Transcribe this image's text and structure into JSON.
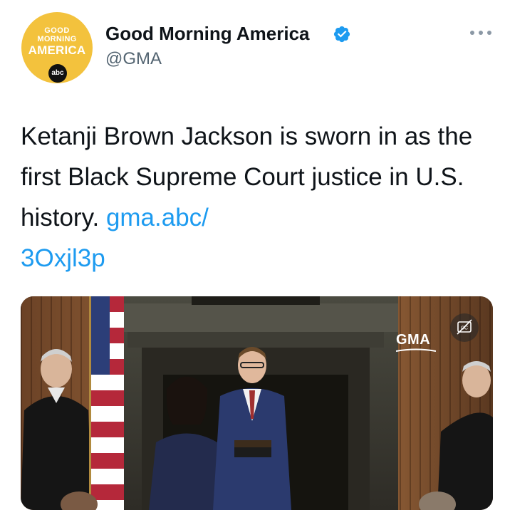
{
  "account": {
    "name": "Good Morning America",
    "handle": "@GMA",
    "verified": true,
    "avatar": {
      "line1": "GOOD",
      "line2": "MORNING",
      "line3": "AMERICA",
      "network": "abc",
      "background": "#f3c23d"
    }
  },
  "tweet": {
    "text_before_link": "Ketanji Brown Jackson is sworn in as the first Black Supreme Court justice in U.S. history. ",
    "link_line1": "gma.abc/",
    "link_line2": "3Oxjl3p"
  },
  "media": {
    "watermark": "GMA",
    "captions_icon": "closed-captions-icon"
  },
  "colors": {
    "link": "#1d9bf0",
    "verified": "#1d9bf0",
    "handle": "#536471",
    "avatar_yellow": "#f3c23d"
  }
}
